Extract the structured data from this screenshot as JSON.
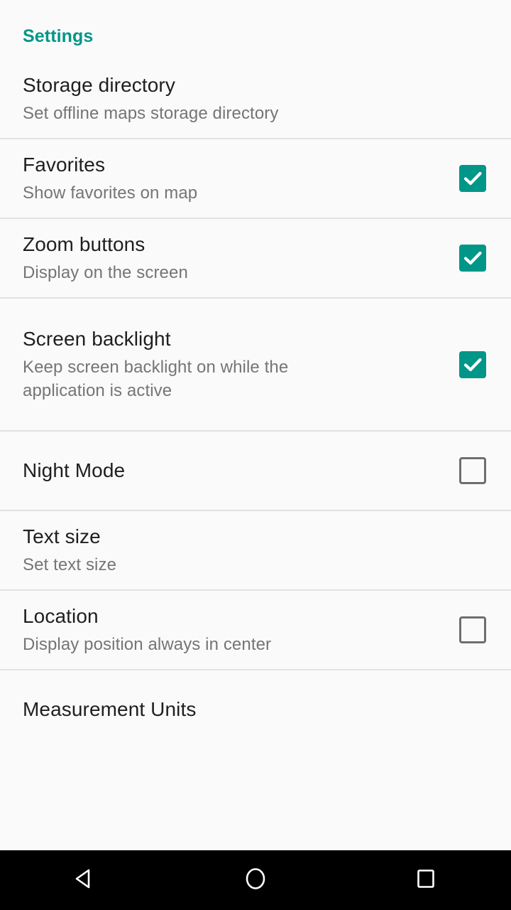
{
  "screen": {
    "app_theme_accent": "#009688",
    "background": "#fafafa",
    "divider_color": "#e2e2e2",
    "title_color": "#1f1f1f",
    "summary_color": "#757575",
    "checkbox_unchecked_color": "#6e6e6e"
  },
  "settings": {
    "section_title": "Settings",
    "items": [
      {
        "title": "Storage directory",
        "summary": "Set offline maps storage directory",
        "widget": "none",
        "checked": false
      },
      {
        "title": "Favorites",
        "summary": "Show favorites on map",
        "widget": "checkbox",
        "checked": true
      },
      {
        "title": "Zoom buttons",
        "summary": "Display on the screen",
        "widget": "checkbox",
        "checked": true
      },
      {
        "title": "Screen backlight",
        "summary": "Keep screen backlight on while the application is active",
        "widget": "checkbox",
        "checked": true
      },
      {
        "title": "Night Mode",
        "summary": "",
        "widget": "checkbox",
        "checked": false
      },
      {
        "title": "Text size",
        "summary": "Set text size",
        "widget": "none",
        "checked": false
      },
      {
        "title": "Location",
        "summary": "Display position always in center",
        "widget": "checkbox",
        "checked": false
      },
      {
        "title": "Measurement Units",
        "summary": "",
        "widget": "none",
        "checked": false
      }
    ]
  },
  "navbar": {
    "back_label": "Back",
    "home_label": "Home",
    "recents_label": "Recent apps"
  }
}
